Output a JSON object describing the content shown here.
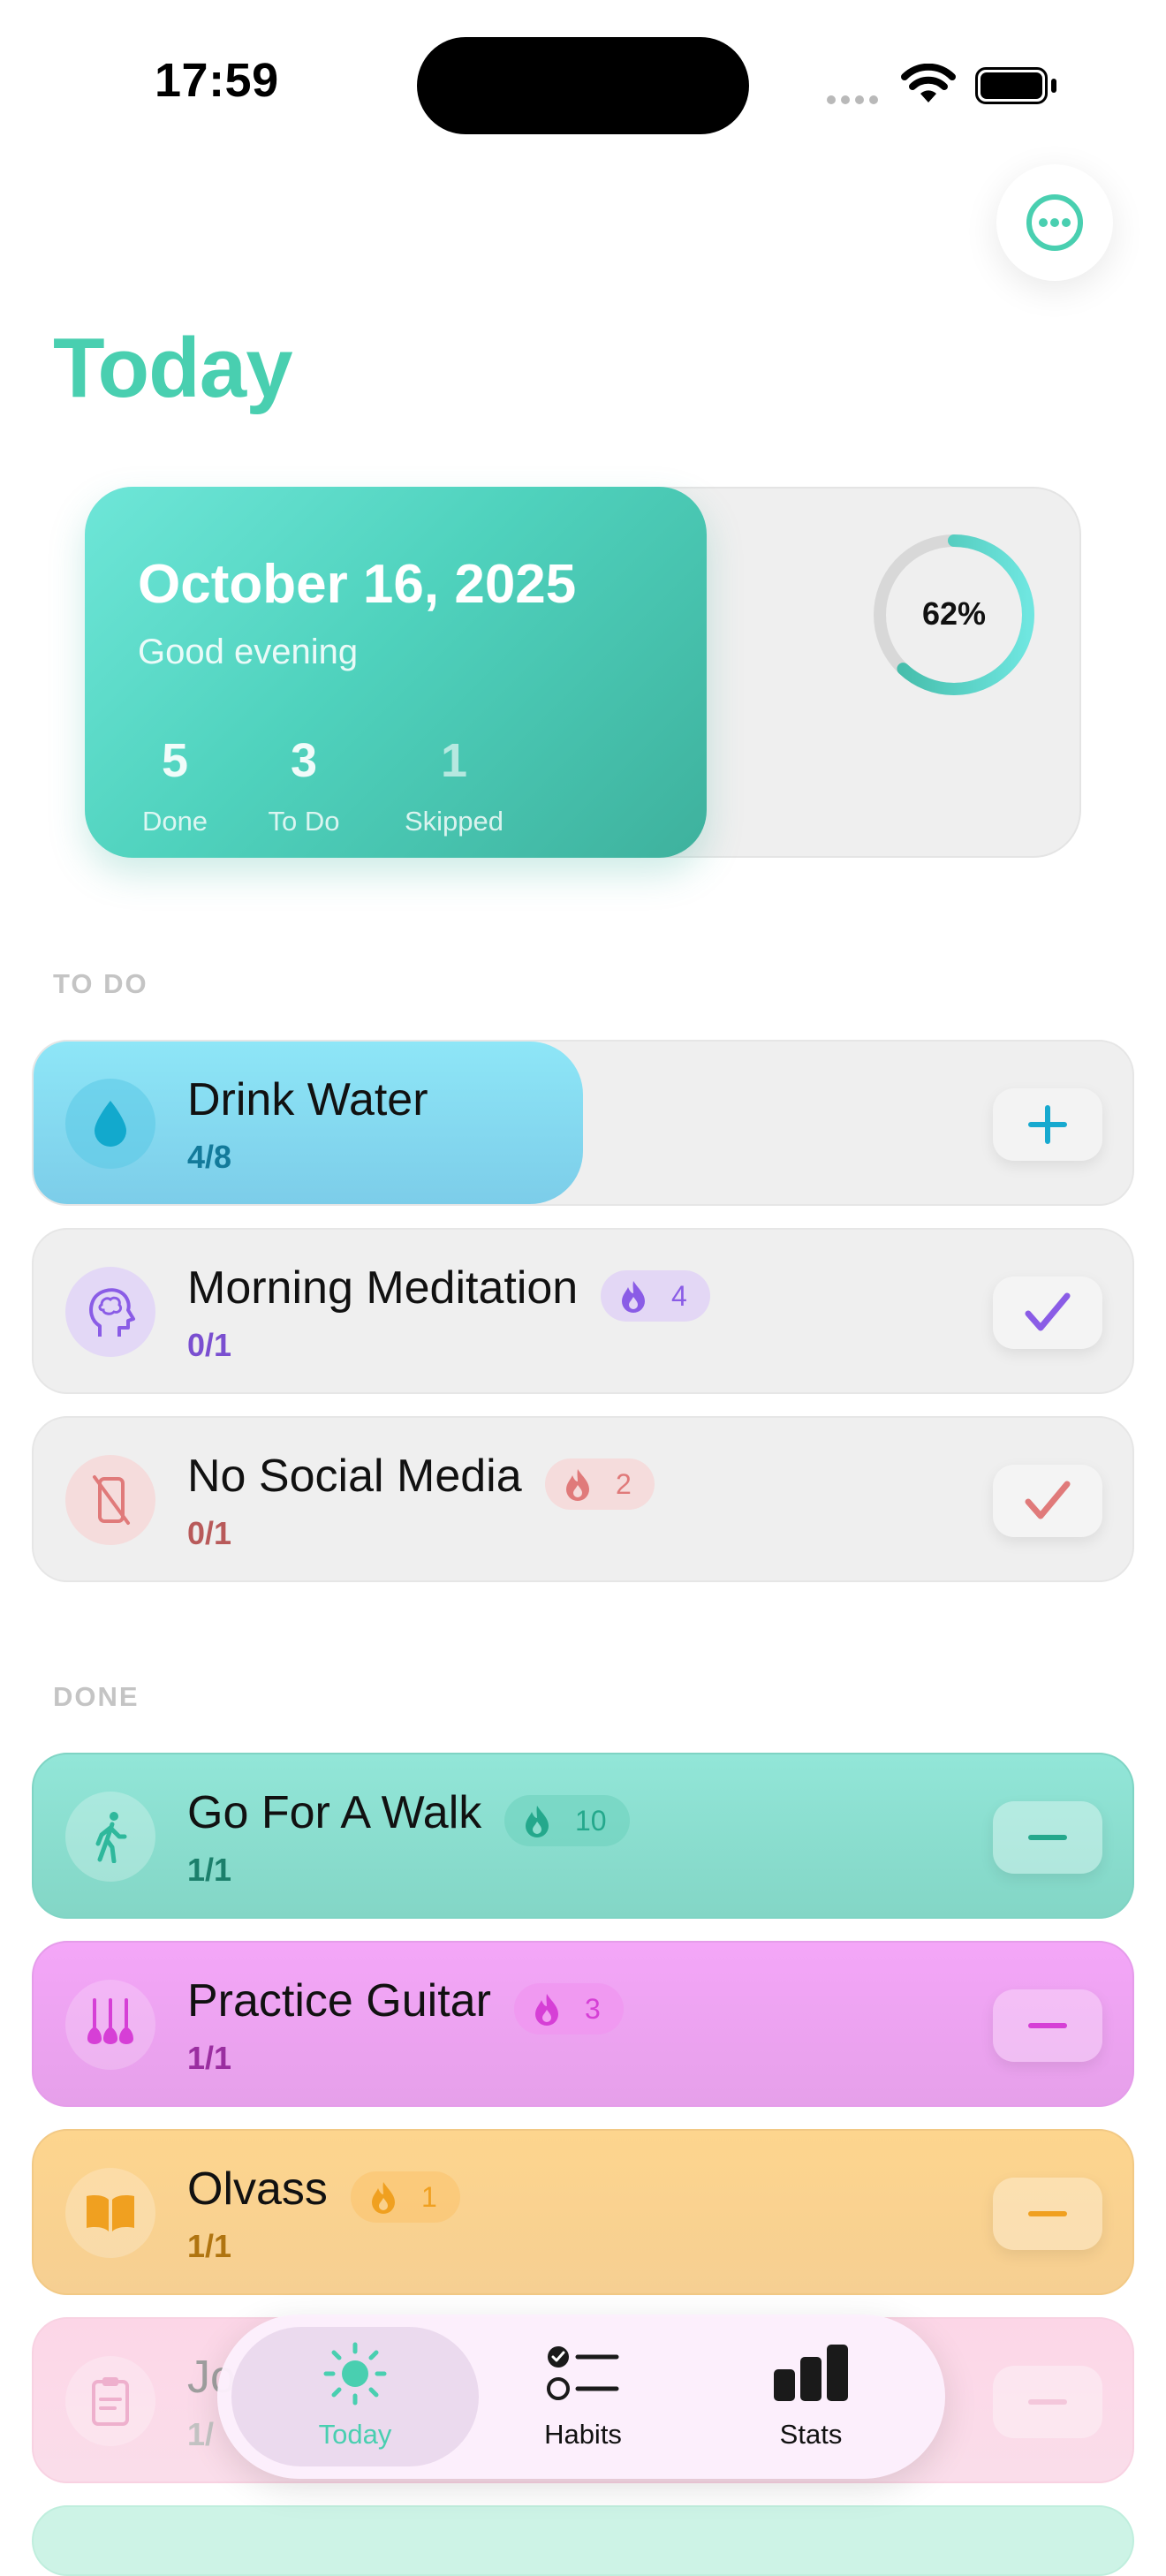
{
  "status_bar": {
    "time": "17:59"
  },
  "header": {
    "title": "Today",
    "more_icon": "ellipsis-circle-icon"
  },
  "summary": {
    "date": "October 16, 2025",
    "greeting": "Good evening",
    "stats": [
      {
        "value": "5",
        "label": "Done"
      },
      {
        "value": "3",
        "label": "To Do"
      },
      {
        "value": "1",
        "label": "Skipped"
      }
    ],
    "completion_label": "62%",
    "completion_fraction": 0.62
  },
  "sections": {
    "todo_label": "TO DO",
    "done_label": "DONE"
  },
  "todo_habits": [
    {
      "name": "Drink Water",
      "progress": "4/8",
      "progress_fraction": 0.5,
      "icon": "water-drop-icon",
      "action": "plus-icon",
      "color": "#17a9cf"
    },
    {
      "name": "Morning Meditation",
      "progress": "0/1",
      "streak": "4",
      "icon": "brain-head-icon",
      "action": "checkmark-icon",
      "color": "#8a5ce6"
    },
    {
      "name": "No Social Media",
      "progress": "0/1",
      "streak": "2",
      "icon": "phone-slash-icon",
      "action": "checkmark-icon",
      "color": "#e07a7a"
    }
  ],
  "done_habits": [
    {
      "name": "Go For A Walk",
      "progress": "1/1",
      "streak": "10",
      "icon": "walking-figure-icon",
      "action": "minus-icon",
      "color": "#2fb89c"
    },
    {
      "name": "Practice Guitar",
      "progress": "1/1",
      "streak": "3",
      "icon": "guitars-icon",
      "action": "minus-icon",
      "color": "#d63fd6"
    },
    {
      "name": "Olvass",
      "progress": "1/1",
      "streak": "1",
      "icon": "open-book-icon",
      "action": "minus-icon",
      "color": "#f0a020"
    },
    {
      "name": "Jo",
      "progress": "1/",
      "icon": "clipboard-icon",
      "action": "minus-icon",
      "color": "#e890b8"
    }
  ],
  "tabbar": {
    "tabs": [
      {
        "label": "Today",
        "icon": "sun-icon",
        "active": true
      },
      {
        "label": "Habits",
        "icon": "checklist-icon",
        "active": false
      },
      {
        "label": "Stats",
        "icon": "bar-chart-icon",
        "active": false
      }
    ],
    "accent": "#49cfb0"
  }
}
